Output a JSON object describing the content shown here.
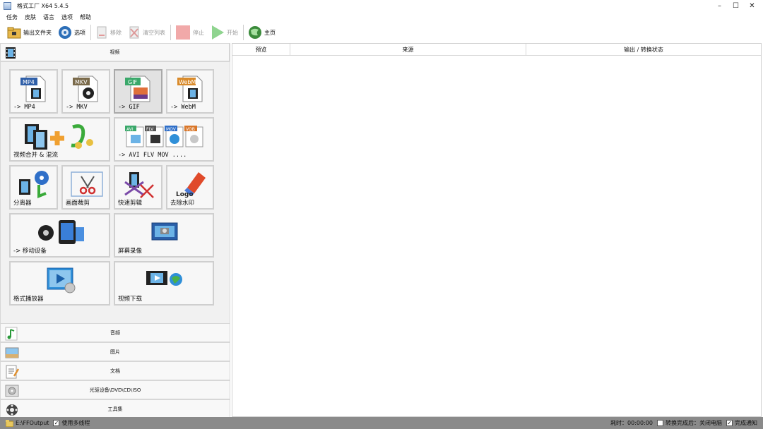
{
  "window": {
    "title": "格式工厂 X64 5.4.5"
  },
  "menu": [
    "任务",
    "皮肤",
    "语言",
    "选项",
    "帮助"
  ],
  "toolbar": {
    "output_folder": "输出文件夹",
    "options": "选项",
    "remove": "移除",
    "clear_list": "清空列表",
    "stop": "停止",
    "start": "开始",
    "home": "主页"
  },
  "categories": {
    "video": "视频",
    "audio": "音频",
    "image": "图片",
    "document": "文档",
    "optical": "光驱设备\\DVD\\CD\\ISO",
    "toolbox": "工具集"
  },
  "tiles": {
    "mp4": {
      "label": "-> MP4",
      "badge": "MP4"
    },
    "mkv": {
      "label": "-> MKV",
      "badge": "MKV"
    },
    "gif": {
      "label": "-> GIF",
      "badge": "GIF"
    },
    "webm": {
      "label": "-> WebM",
      "badge": "WebM"
    },
    "merge": {
      "label": "视频合并 & 混流"
    },
    "multi": {
      "label": "-> AVI FLV MOV ....",
      "badges": [
        "AVI",
        "FLV",
        "MOV",
        "VOB"
      ]
    },
    "splitter": {
      "label": "分离器"
    },
    "crop": {
      "label": "画面裁剪"
    },
    "quickcut": {
      "label": "快速剪辑"
    },
    "watermark": {
      "label": "去除水印",
      "logo_text": "Logo"
    },
    "mobile": {
      "label": "-> 移动设备"
    },
    "recorder": {
      "label": "屏幕录像"
    },
    "player": {
      "label": "格式播放器"
    },
    "download": {
      "label": "视频下载"
    }
  },
  "table": {
    "columns": [
      "预览",
      "来源",
      "输出 / 转换状态"
    ]
  },
  "statusbar": {
    "output_path": "E:\\FFOutput",
    "multithread": "使用多线程",
    "elapsed": "耗时：00:00:00",
    "after_convert": "转换完成后：关闭电脑",
    "notify": "完成通知"
  },
  "colors": {
    "mp4": "#2f5fa8",
    "mkv": "#7a6a4a",
    "gif": "#3aa86a",
    "webm": "#d98a2a",
    "stop": "#f1a9a9",
    "start": "#8fd48f",
    "statusbar": "#8a8a8a"
  }
}
